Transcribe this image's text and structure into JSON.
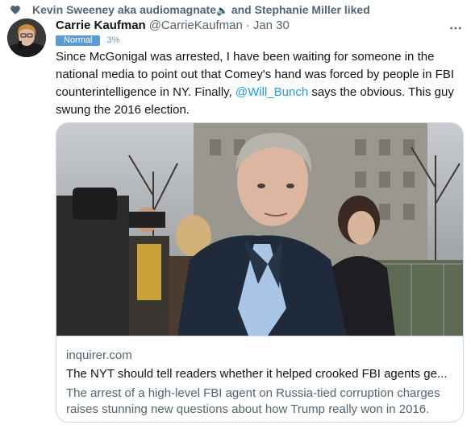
{
  "social_context": {
    "text": "Kevin Sweeney aka audiomagnate",
    "speaker_glyph": "🔈",
    "suffix": "and Stephanie Miller liked",
    "icon": "heart-icon"
  },
  "tweet": {
    "display_name": "Carrie Kaufman",
    "handle": "@CarrieKaufman",
    "separator": "·",
    "time": "Jan 30",
    "more_icon": "more-icon",
    "badge": "Normal",
    "badge_percent": "3%",
    "text_part1": "Since McGonigal was arrested, I have been waiting for someone in the national media to point out that Comey's hand was forced by people in FBI counterintelligence in NY. Finally, ",
    "mention": "@Will_Bunch",
    "text_part2": " says the obvious. This guy swung the 2016 election."
  },
  "card": {
    "domain": "inquirer.com",
    "title": "The NYT should tell readers whether it helped crooked FBI agents ge...",
    "description": "The arrest of a high-level FBI agent on Russia-tied corruption charges raises stunning new questions about how Trump really won in 2016."
  },
  "colors": {
    "accent": "#1d9bf0",
    "secondary_text": "#536471",
    "badge_bg": "#5b9bd5",
    "border": "#cfd9de"
  }
}
